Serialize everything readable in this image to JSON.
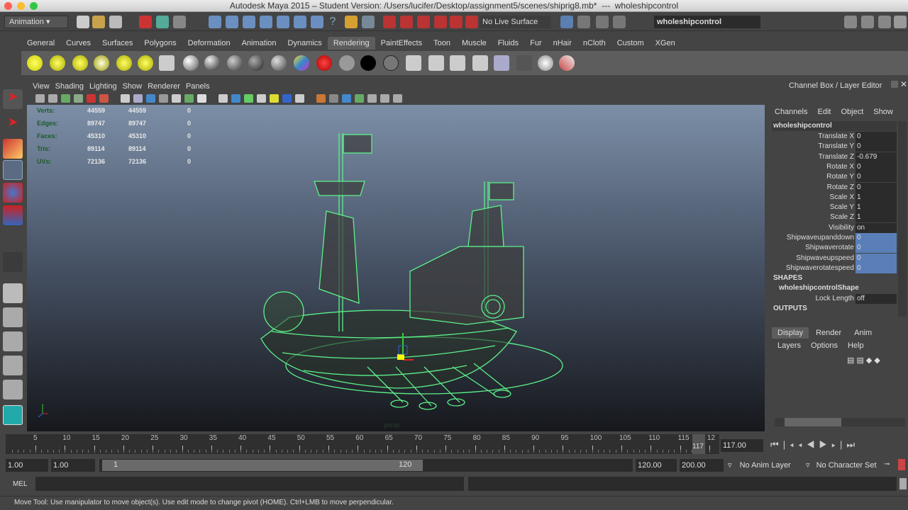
{
  "title": "Autodesk Maya 2015 – Student Version: /Users/lucifer/Desktop/assignment5/scenes/shiprig8.mb*  ---  wholeshipcontrol",
  "status_line": {
    "menu_set": "Animation",
    "live_surface": "No Live Surface",
    "selection_field": "wholeshipcontrol"
  },
  "shelf_tabs": [
    "General",
    "Curves",
    "Surfaces",
    "Polygons",
    "Deformation",
    "Animation",
    "Dynamics",
    "Rendering",
    "PaintEffects",
    "Toon",
    "Muscle",
    "Fluids",
    "Fur",
    "nHair",
    "nCloth",
    "Custom",
    "XGen"
  ],
  "active_shelf": "Rendering",
  "panel_menu": [
    "View",
    "Shading",
    "Lighting",
    "Show",
    "Renderer",
    "Panels"
  ],
  "hud": [
    {
      "label": "Verts:",
      "a": "44559",
      "b": "44559",
      "c": "0"
    },
    {
      "label": "Edges:",
      "a": "89747",
      "b": "89747",
      "c": "0"
    },
    {
      "label": "Faces:",
      "a": "45310",
      "b": "45310",
      "c": "0"
    },
    {
      "label": "Tris:",
      "a": "89114",
      "b": "89114",
      "c": "0"
    },
    {
      "label": "UVs:",
      "a": "72136",
      "b": "72136",
      "c": "0"
    }
  ],
  "camera_label": "persp",
  "channel_box": {
    "title": "Channel Box / Layer Editor",
    "menu": [
      "Channels",
      "Edit",
      "Object",
      "Show"
    ],
    "object": "wholeshipcontrol",
    "channels": [
      {
        "name": "Translate X",
        "value": "0"
      },
      {
        "name": "Translate Y",
        "value": "0"
      },
      {
        "name": "Translate Z",
        "value": "-0.679"
      },
      {
        "name": "Rotate X",
        "value": "0"
      },
      {
        "name": "Rotate Y",
        "value": "0"
      },
      {
        "name": "Rotate Z",
        "value": "0"
      },
      {
        "name": "Scale X",
        "value": "1"
      },
      {
        "name": "Scale Y",
        "value": "1"
      },
      {
        "name": "Scale Z",
        "value": "1"
      },
      {
        "name": "Visibility",
        "value": "on"
      },
      {
        "name": "Shipwaveupanddown",
        "value": "0"
      },
      {
        "name": "Shipwaverotate",
        "value": "0"
      },
      {
        "name": "Shipwaveupspeed",
        "value": "0"
      },
      {
        "name": "Shipwaverotatespeed",
        "value": "0"
      }
    ],
    "shapes_header": "SHAPES",
    "shape_name": "wholeshipcontrolShape",
    "shape_channel": {
      "name": "Lock Length",
      "value": "off"
    },
    "outputs_header": "OUTPUTS"
  },
  "layer_editor": {
    "tabs": [
      "Display",
      "Render",
      "Anim"
    ],
    "menu": [
      "Layers",
      "Options",
      "Help"
    ]
  },
  "timeline": {
    "ticks": [
      "5",
      "10",
      "15",
      "20",
      "25",
      "30",
      "35",
      "40",
      "45",
      "50",
      "55",
      "60",
      "65",
      "70",
      "75",
      "80",
      "85",
      "90",
      "95",
      "100",
      "105",
      "110",
      "115",
      "12"
    ],
    "current_frame_marker": "117",
    "current_time": "117.00"
  },
  "range": {
    "start": "1.00",
    "playback_start": "1.00",
    "slider_start": "1",
    "slider_end": "120",
    "playback_end": "120.00",
    "end": "200.00",
    "anim_layer": "No Anim Layer",
    "character_set": "No Character Set"
  },
  "command_line": {
    "label": "MEL"
  },
  "help_line": "Move Tool: Use manipulator to move object(s). Use edit mode to change pivot (HOME).  Ctrl+LMB to move perpendicular."
}
